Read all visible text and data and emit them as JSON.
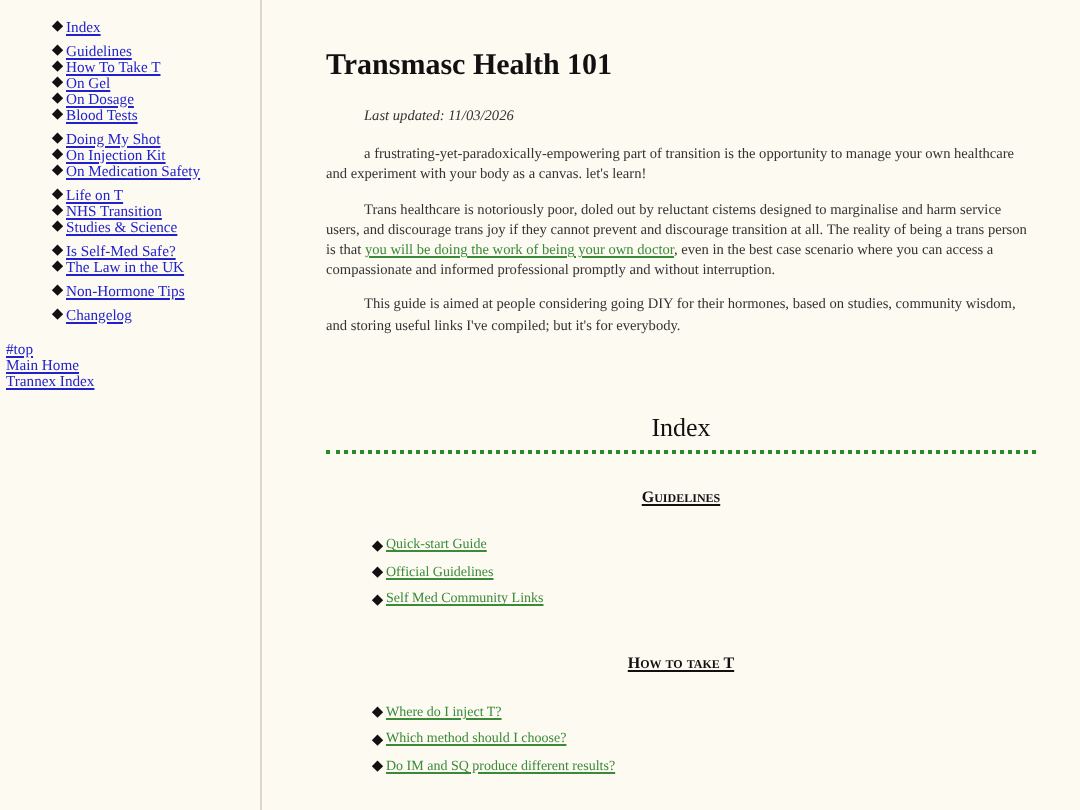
{
  "sidebar": {
    "groups": [
      [
        "Index"
      ],
      [
        "Guidelines",
        "How To Take T",
        "On Gel",
        "On Dosage",
        "Blood Tests"
      ],
      [
        "Doing My Shot",
        "On Injection Kit",
        "On Medication Safety"
      ],
      [
        "Life on T",
        "NHS Transition",
        "Studies & Science"
      ],
      [
        "Is Self-Med Safe?",
        "The Law in the UK"
      ],
      [
        "Non-Hormone Tips"
      ],
      [
        "Changelog"
      ]
    ],
    "footer_links": [
      "#top",
      "Main Home",
      "Trannex Index"
    ]
  },
  "main": {
    "title": "Transmasc Health 101",
    "last_updated": "Last updated: 11/03/2026",
    "paragraphs": [
      {
        "before": "a frustrating-yet-paradoxically-empowering part of transition is the opportunity to manage your own healthcare and experiment with your body as a canvas. let's learn!"
      },
      {
        "before": "Trans healthcare is notoriously poor, doled out by reluctant cistems designed to marginalise and harm service users, and discourage trans joy if they cannot prevent and discourage transition at all. The reality of being a trans person is that ",
        "link": "you will be doing the work of being your own doctor",
        "after": ", even in the best case scenario where you can access a compassionate and informed professional promptly and without interruption."
      },
      {
        "before": "This guide is aimed at people considering going DIY for their hormones, based on studies, community wisdom, and storing useful links I've compiled; but it's for everybody."
      }
    ]
  },
  "index": {
    "heading": "Index",
    "sections": [
      {
        "heading": "Guidelines",
        "links": [
          "Quick-start Guide",
          "Official Guidelines",
          "Self Med Community Links"
        ]
      },
      {
        "heading": "How to take T",
        "links": [
          "Where do I inject T?",
          "Which method should I choose?",
          "Do IM and SQ produce different results?"
        ]
      }
    ]
  }
}
